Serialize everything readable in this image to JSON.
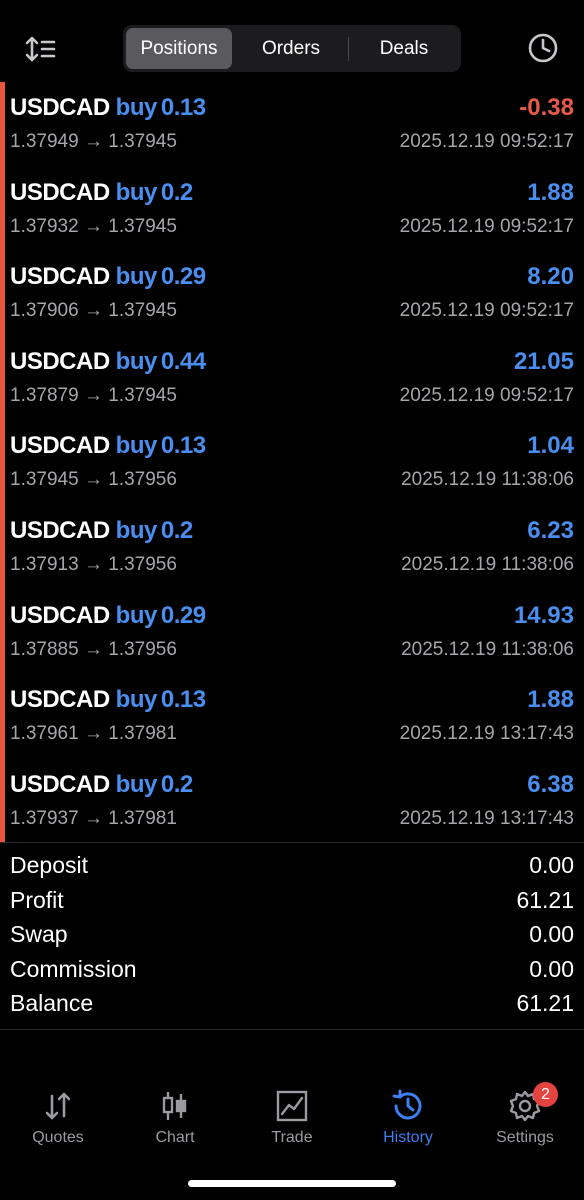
{
  "header": {
    "tabs": [
      {
        "label": "Positions",
        "active": true
      },
      {
        "label": "Orders",
        "active": false
      },
      {
        "label": "Deals",
        "active": false
      }
    ],
    "sort_icon": "sort-arrows-icon",
    "history_icon": "clock-icon"
  },
  "positions": [
    {
      "symbol": "USDCAD",
      "side": "buy",
      "volume": "0.13",
      "open": "1.37949",
      "current": "1.37945",
      "arrow": "→",
      "time": "2025.12.19 09:52:17",
      "profit": "-0.38",
      "negative": true
    },
    {
      "symbol": "USDCAD",
      "side": "buy",
      "volume": "0.2",
      "open": "1.37932",
      "current": "1.37945",
      "arrow": "→",
      "time": "2025.12.19 09:52:17",
      "profit": "1.88",
      "negative": false
    },
    {
      "symbol": "USDCAD",
      "side": "buy",
      "volume": "0.29",
      "open": "1.37906",
      "current": "1.37945",
      "arrow": "→",
      "time": "2025.12.19 09:52:17",
      "profit": "8.20",
      "negative": false
    },
    {
      "symbol": "USDCAD",
      "side": "buy",
      "volume": "0.44",
      "open": "1.37879",
      "current": "1.37945",
      "arrow": "→",
      "time": "2025.12.19 09:52:17",
      "profit": "21.05",
      "negative": false
    },
    {
      "symbol": "USDCAD",
      "side": "buy",
      "volume": "0.13",
      "open": "1.37945",
      "current": "1.37956",
      "arrow": "→",
      "time": "2025.12.19 11:38:06",
      "profit": "1.04",
      "negative": false
    },
    {
      "symbol": "USDCAD",
      "side": "buy",
      "volume": "0.2",
      "open": "1.37913",
      "current": "1.37956",
      "arrow": "→",
      "time": "2025.12.19 11:38:06",
      "profit": "6.23",
      "negative": false
    },
    {
      "symbol": "USDCAD",
      "side": "buy",
      "volume": "0.29",
      "open": "1.37885",
      "current": "1.37956",
      "arrow": "→",
      "time": "2025.12.19 11:38:06",
      "profit": "14.93",
      "negative": false
    },
    {
      "symbol": "USDCAD",
      "side": "buy",
      "volume": "0.13",
      "open": "1.37961",
      "current": "1.37981",
      "arrow": "→",
      "time": "2025.12.19 13:17:43",
      "profit": "1.88",
      "negative": false
    },
    {
      "symbol": "USDCAD",
      "side": "buy",
      "volume": "0.2",
      "open": "1.37937",
      "current": "1.37981",
      "arrow": "→",
      "time": "2025.12.19 13:17:43",
      "profit": "6.38",
      "negative": false
    }
  ],
  "summary": [
    {
      "label": "Deposit",
      "value": "0.00"
    },
    {
      "label": "Profit",
      "value": "61.21"
    },
    {
      "label": "Swap",
      "value": "0.00"
    },
    {
      "label": "Commission",
      "value": "0.00"
    },
    {
      "label": "Balance",
      "value": "61.21"
    }
  ],
  "tabbar": {
    "items": [
      {
        "label": "Quotes",
        "icon": "quotes-arrows-icon",
        "active": false
      },
      {
        "label": "Chart",
        "icon": "candlestick-chart-icon",
        "active": false
      },
      {
        "label": "Trade",
        "icon": "trade-chart-icon",
        "active": false
      },
      {
        "label": "History",
        "icon": "history-clock-icon",
        "active": true
      },
      {
        "label": "Settings",
        "icon": "gear-icon",
        "active": false
      }
    ],
    "settings_badge": "2"
  },
  "colors": {
    "background": "#000000",
    "buy_blue": "#4a8ef0",
    "loss_red": "#e85a4a",
    "accent_bar": "#e8553b",
    "tab_active": "#3d7ff0",
    "badge": "#e5443e"
  }
}
